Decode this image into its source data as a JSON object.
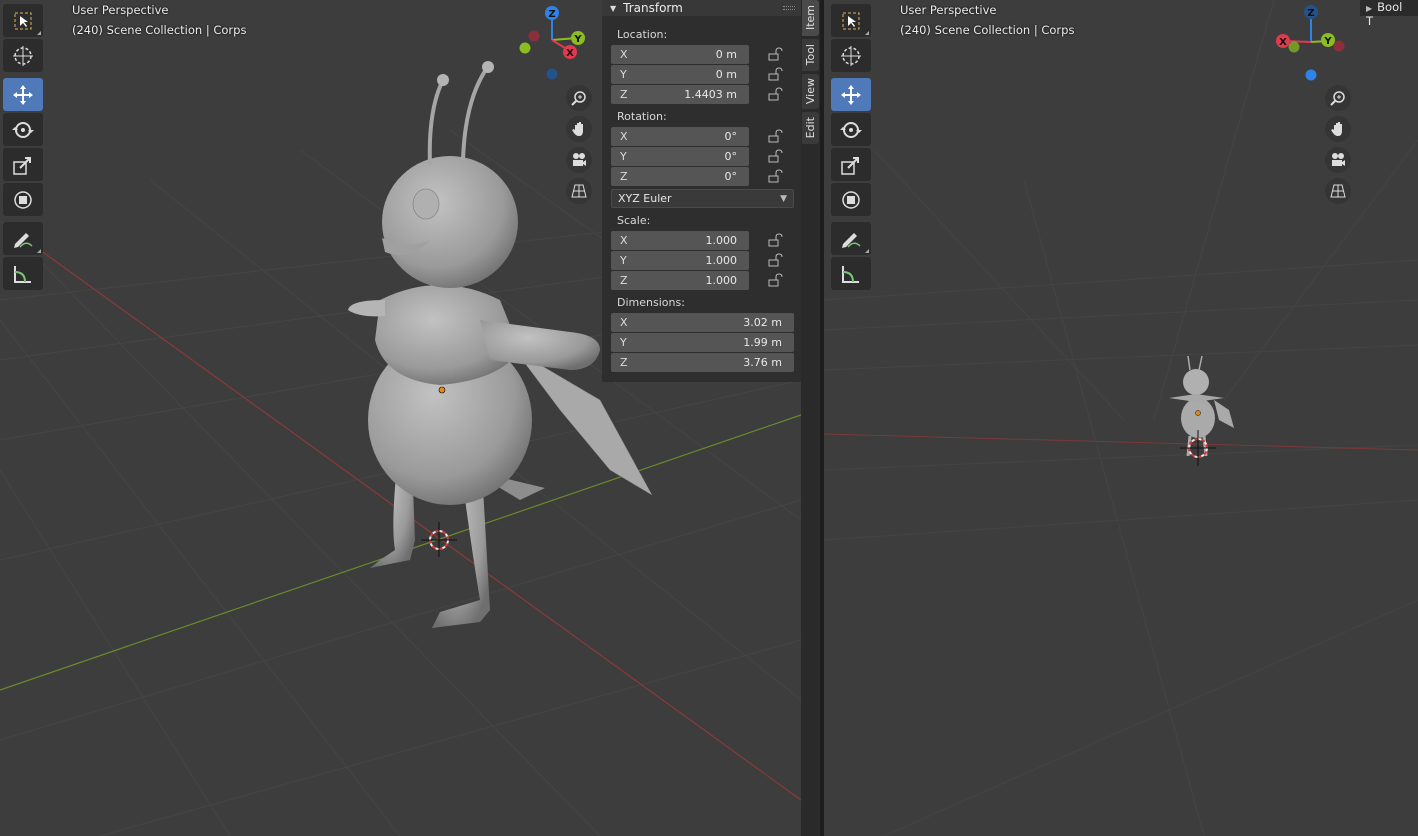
{
  "left_viewport": {
    "perspective": "User Perspective",
    "collection": "(240) Scene Collection | Corps"
  },
  "right_viewport": {
    "perspective": "User Perspective",
    "collection": "(240) Scene Collection | Corps",
    "bool_tab": "Bool T"
  },
  "gizmo": {
    "x": "X",
    "y": "Y",
    "z": "Z"
  },
  "toolbar": [
    "select-box-icon",
    "cursor-icon",
    "move-icon",
    "rotate-icon",
    "scale-icon",
    "transform-icon",
    "annotate-icon",
    "measure-icon"
  ],
  "colors": {
    "accent": "#4f79b8",
    "x_axis": "#e2394e",
    "y_axis": "#8bbd22",
    "z_axis": "#2f82e8"
  },
  "npanel": {
    "title": "Transform",
    "location": {
      "label": "Location:",
      "x": "0 m",
      "y": "0 m",
      "z": "1.4403 m"
    },
    "rotation": {
      "label": "Rotation:",
      "x": "0°",
      "y": "0°",
      "z": "0°"
    },
    "rotation_mode": "XYZ Euler",
    "scale": {
      "label": "Scale:",
      "x": "1.000",
      "y": "1.000",
      "z": "1.000"
    },
    "dimensions": {
      "label": "Dimensions:",
      "x": "3.02 m",
      "y": "1.99 m",
      "z": "3.76 m"
    },
    "axis": {
      "x": "X",
      "y": "Y",
      "z": "Z"
    }
  },
  "tabs": [
    "Item",
    "Tool",
    "View",
    "Edit"
  ]
}
